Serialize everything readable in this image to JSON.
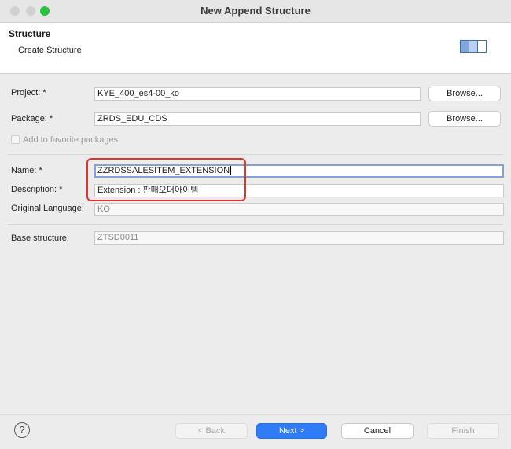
{
  "window": {
    "title": "New Append Structure"
  },
  "header": {
    "title": "Structure",
    "subtitle": "Create Structure"
  },
  "form": {
    "project": {
      "label": "Project: *",
      "value": "KYE_400_es4-00_ko",
      "browse_label": "Browse..."
    },
    "package": {
      "label": "Package: *",
      "value": "ZRDS_EDU_CDS",
      "browse_label": "Browse..."
    },
    "favorite": {
      "label": "Add to favorite packages",
      "checked": false
    },
    "name": {
      "label": "Name: *",
      "value": "ZZRDSSALESITEM_EXTENSION"
    },
    "description": {
      "label": "Description: *",
      "value": "Extension : 판매오더아이템"
    },
    "original_language": {
      "label": "Original Language:",
      "value": "KO"
    },
    "base_structure": {
      "label": "Base structure:",
      "value": "ZTSD0011"
    }
  },
  "buttons": {
    "help": "?",
    "back": "< Back",
    "next": "Next >",
    "cancel": "Cancel",
    "finish": "Finish"
  },
  "colors": {
    "highlight": "#e0352b",
    "primary": "#2e7cf6",
    "focus": "#7fa2d9"
  }
}
